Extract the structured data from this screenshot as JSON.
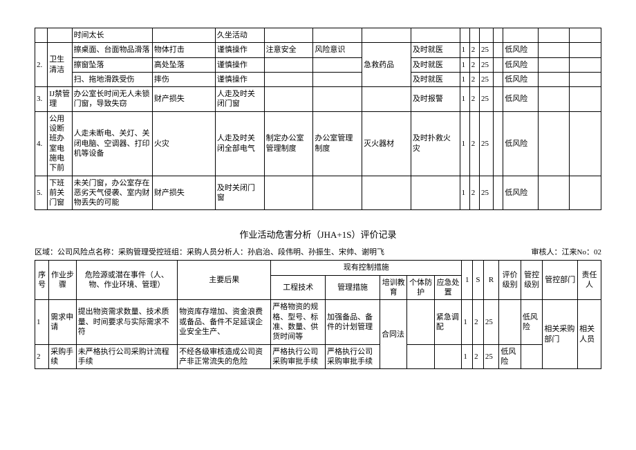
{
  "table1": {
    "rows": [
      {
        "seq": "",
        "step": "",
        "hazard": "时间太长",
        "cons": "",
        "m1": "久坐活动",
        "m2": "",
        "m3": "",
        "m4": "",
        "m5": "",
        "l": "",
        "s": "",
        "r": "",
        "eval": "",
        "risk": "",
        "dept": "",
        "resp": ""
      },
      {
        "seq": "2.",
        "step": "卫生清洁",
        "sub": [
          {
            "hazard": "擦桌面、台面物品滑落",
            "cons": "物体打击",
            "m1": "谨慎操作",
            "m2": "注意安全",
            "m3": "风险意识",
            "m4": "急救药品",
            "m5": "及时就医",
            "l": "1",
            "s": "2",
            "r": "25",
            "eval": "",
            "risk": "低风险"
          },
          {
            "hazard": "擦窗坠落",
            "cons": "高处坠落",
            "m1": "谨慎操作",
            "m2": "",
            "m3": "",
            "m4": "",
            "m5": "及时就医",
            "l": "1",
            "s": "2",
            "r": "25",
            "eval": "",
            "risk": "低风险"
          },
          {
            "hazard": "扫、拖地滑跌受伤",
            "cons": "摔伤",
            "m1": "谨慎操作",
            "m2": "",
            "m3": "",
            "m4": "",
            "m5": "及时就医",
            "l": "1",
            "s": "2",
            "r": "25",
            "eval": "",
            "risk": "低风险"
          }
        ]
      },
      {
        "seq": "3.",
        "step": "IJ禁管理",
        "hazard": "办公室长时间无人未锁门窗，导致失窃",
        "cons": "财产损失",
        "m1": "人走及时关闭门窗",
        "m2": "",
        "m3": "",
        "m4": "",
        "m5": "及时报警",
        "l": "1",
        "s": "2",
        "r": "25",
        "eval": "",
        "risk": "低风险"
      },
      {
        "seq": "4.",
        "step": "公用设断班办室电施电下前",
        "hazard": "人走未断电、关灯、关闭电脑、空调器、打印机等设备",
        "cons": "火灾",
        "m1": "人走及时关闭全部电气",
        "m2": "制定办公室管理制度",
        "m3": "办公室管理制度",
        "m4": "灭火器材",
        "m5": "及时扑救火灾",
        "l": "1",
        "s": "2",
        "r": "25",
        "eval": "",
        "risk": "低风险"
      },
      {
        "seq": "5.",
        "step": "下班前关门窗",
        "hazard": "未关门窗，办公室存在恶劣天气侵袭、室内财物丢失的可能",
        "cons": "财产损失",
        "m1": "及时关闭门窗",
        "m2": "",
        "m3": "",
        "m4": "",
        "m5": "",
        "l": "1",
        "s": "2",
        "r": "25",
        "eval": "",
        "risk": "低风险"
      }
    ]
  },
  "title2": "作业活动危害分析（JHA+1S）评价记录",
  "meta2_left": "区域：公司风险点名称：采购管理受控班组：采购人员分析人：孙启治、段伟明、孙振生、宋帅、谢明飞",
  "meta2_right": "审核人：江来No：02",
  "table2": {
    "headers": {
      "seq": "序号",
      "step": "作业步骤",
      "hazard": "危险源或潜在事件（人、物、作业环境、管理）",
      "cons": "主要后果",
      "ctrl": "现有控制措施",
      "c1": "工程技术",
      "c2": "管理措施",
      "c3": "培训教育",
      "c4": "个体防护",
      "c5": "应急处置",
      "l": "1",
      "s": "S",
      "r": "R",
      "eval": "评价级别",
      "risk": "管控级别",
      "dept": "管控部门",
      "resp": "责任人"
    },
    "rows": [
      {
        "seq": "1",
        "step": "需求申请",
        "hazard": "提出物资需求数量、技术质量、时间要求与实际需求不符",
        "cons": "物资库存增加、资金浪费或备品、备件不足延误企业安全生产、",
        "c1": "严格物资的规格、型号、标准、数量、供货时间等",
        "c2": "加强备品、备件的计划管理",
        "c3": "",
        "c4": "",
        "c5": "紧急调配",
        "l": "1",
        "s": "2",
        "r": "25",
        "eval": "",
        "risk": "低风险",
        "dept": "相关采购部门",
        "resp": "相关人员"
      },
      {
        "seq": "2",
        "step": "采购手续",
        "hazard": "未严格执行公司采购计流程手续",
        "cons": "不经各级审核造成公司资产非正常流失的危险",
        "c1": "严格执行公司采购审批手续",
        "c2": "严格执行公司采购审批手续",
        "c3": "合同法",
        "c4": "",
        "c5": "",
        "l": "1",
        "s": "2",
        "r": "25",
        "eval": "低风险",
        "risk": "",
        "dept": "",
        "resp": ""
      }
    ]
  }
}
